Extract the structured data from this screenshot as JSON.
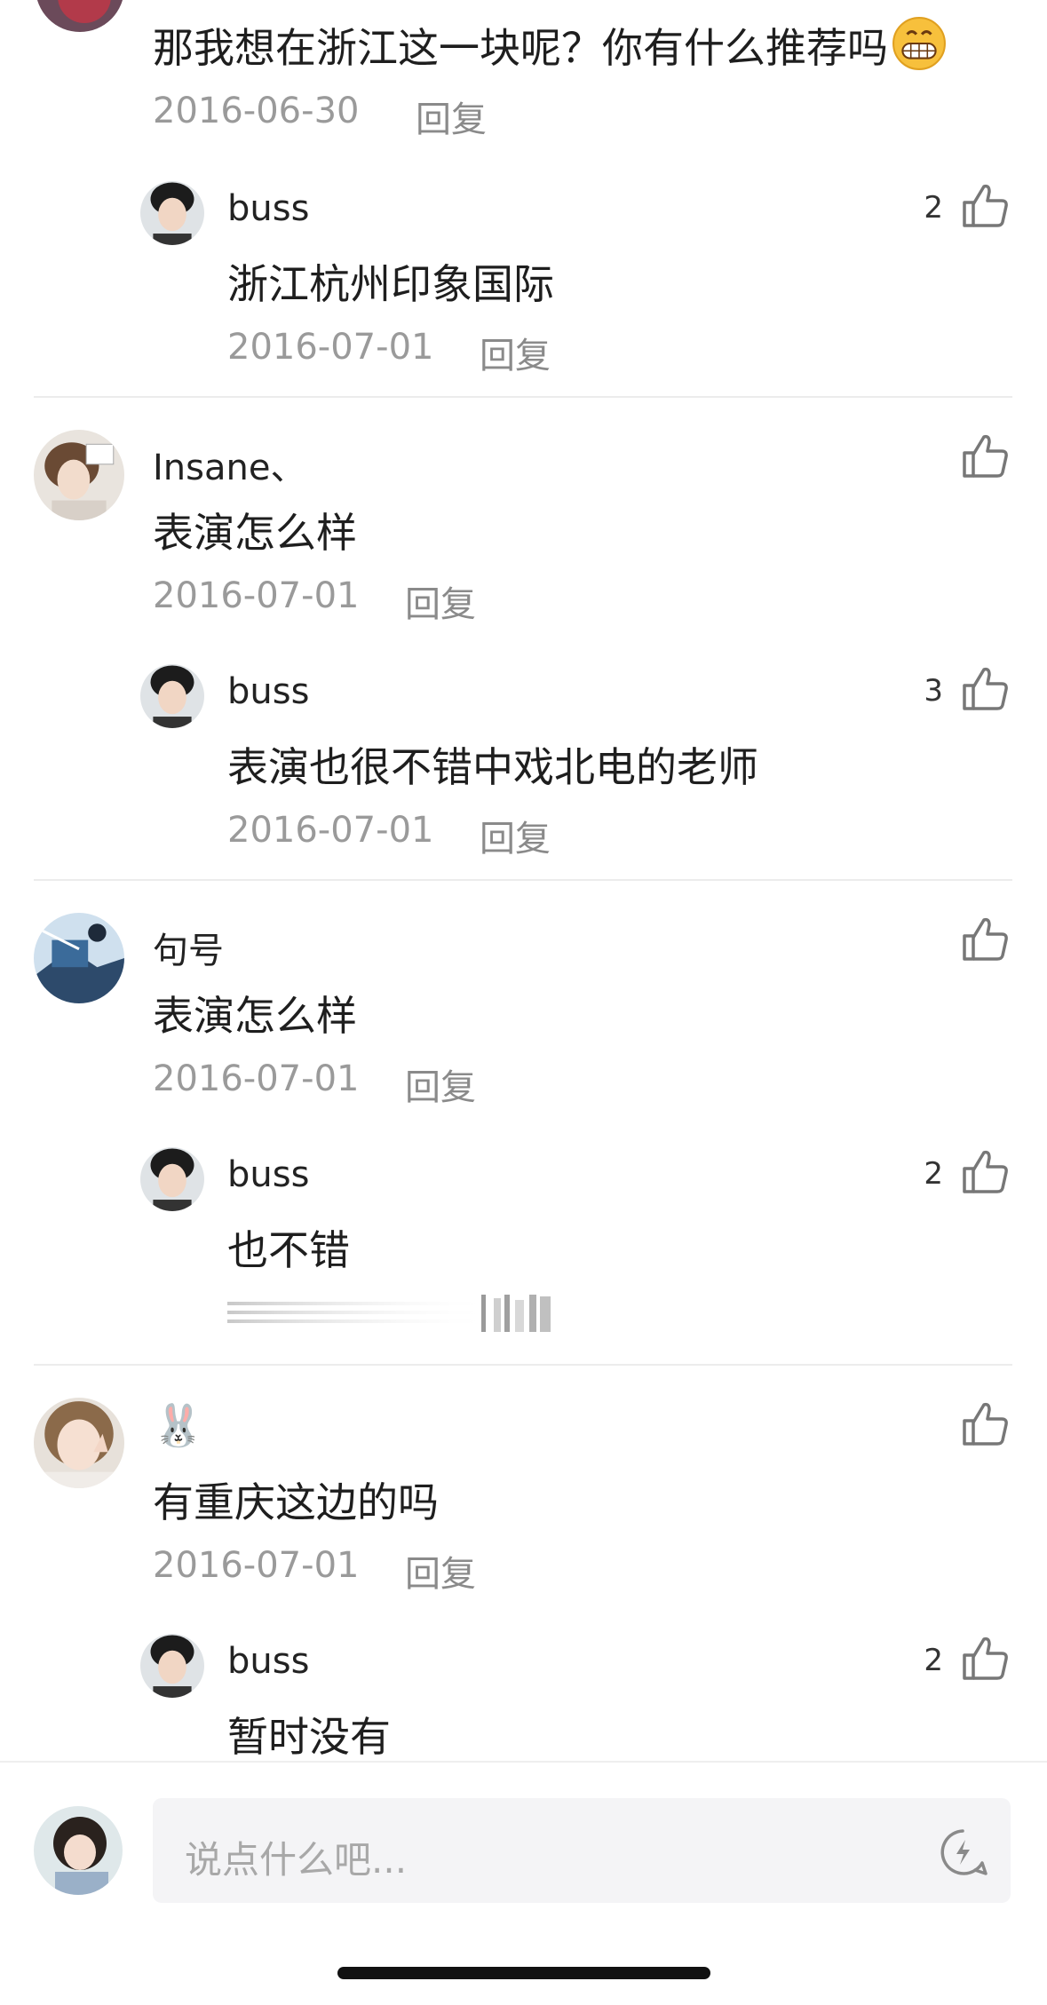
{
  "comments": [
    {
      "id": "c0",
      "content": "那我想在浙江这一块呢？你有什么推荐吗",
      "inline_emoji": "grin-emoji",
      "date": "2016-06-30",
      "reply_label": "回复",
      "reply": {
        "name": "buss",
        "content": "浙江杭州印象国际",
        "date": "2016-07-01",
        "reply_label": "回复",
        "likes": "2"
      }
    },
    {
      "id": "c1",
      "name": "Insane、",
      "content": "表演怎么样",
      "date": "2016-07-01",
      "reply_label": "回复",
      "reply": {
        "name": "buss",
        "content": "表演也很不错中戏北电的老师",
        "date": "2016-07-01",
        "reply_label": "回复",
        "likes": "3"
      }
    },
    {
      "id": "c2",
      "name": "句号",
      "content": "表演怎么样",
      "date": "2016-07-01",
      "reply_label": "回复",
      "reply": {
        "name": "buss",
        "content": "也不错",
        "likes": "2"
      }
    },
    {
      "id": "c3",
      "name": "🐰",
      "content": "有重庆这边的吗",
      "date": "2016-07-01",
      "reply_label": "回复",
      "reply": {
        "name": "buss",
        "content": "暂时没有",
        "likes": "2"
      }
    }
  ],
  "composer": {
    "placeholder": "说点什么吧..."
  },
  "colors": {
    "secondary_text": "#9a9a9a",
    "divider": "#ececec",
    "input_bg": "#f4f4f6"
  }
}
